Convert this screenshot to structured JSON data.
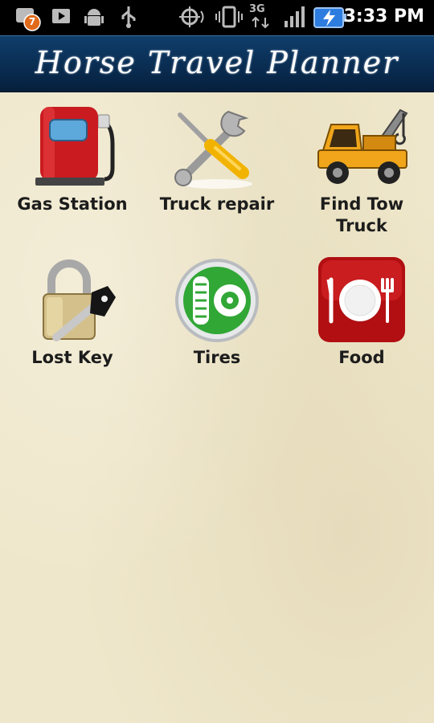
{
  "status_bar": {
    "notification_count": "7",
    "network": "3G",
    "time": "3:33 PM"
  },
  "app": {
    "title": "Horse Travel Planner"
  },
  "tiles": [
    {
      "label": "Gas Station",
      "icon": "gas-pump-icon"
    },
    {
      "label": "Truck repair",
      "icon": "wrench-screwdriver-icon"
    },
    {
      "label": "Find Tow Truck",
      "icon": "tow-truck-icon"
    },
    {
      "label": "Lost Key",
      "icon": "padlock-key-icon"
    },
    {
      "label": "Tires",
      "icon": "tire-icon"
    },
    {
      "label": "Food",
      "icon": "plate-fork-knife-icon"
    }
  ],
  "colors": {
    "status_bar": "#000000",
    "title_bar": "#0a2d52",
    "background": "#efe7cb",
    "label_text": "#1c1c1c"
  }
}
